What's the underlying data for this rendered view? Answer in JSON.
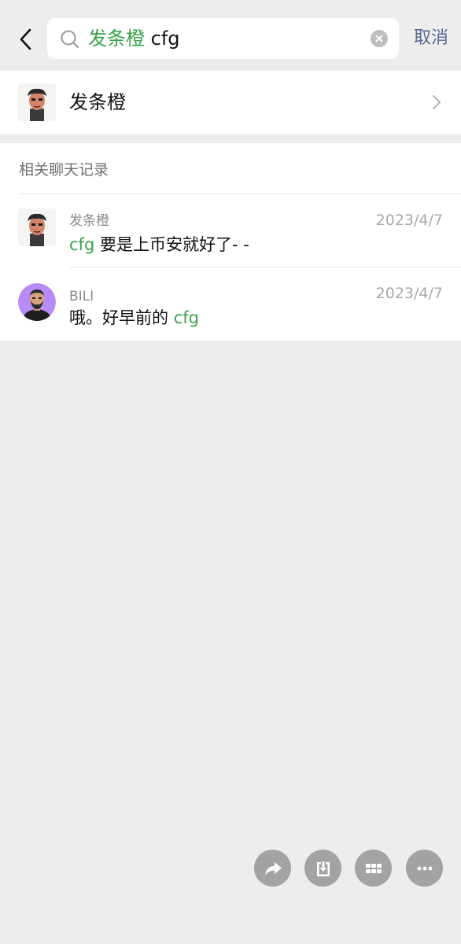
{
  "header": {
    "back_label": "返回",
    "search": {
      "highlight": "发条橙",
      "rest": " cfg"
    },
    "cancel_label": "取消"
  },
  "contact": {
    "name": "发条橙"
  },
  "records": {
    "title": "相关聊天记录",
    "items": [
      {
        "name": "发条橙",
        "date": "2023/4/7",
        "msg_highlight": "cfg",
        "msg_rest": " 要是上币安就好了- -"
      },
      {
        "name": "BILI",
        "date": "2023/4/7",
        "msg_prefix": "哦。好早前的 ",
        "msg_highlight": "cfg"
      }
    ]
  },
  "bottom_actions": [
    "share-icon",
    "save-icon",
    "grid-icon",
    "more-icon"
  ],
  "colors": {
    "highlight": "#3aa24a",
    "cancel": "#576b95",
    "background": "#ededed",
    "bili_avatar_bg": "#b88cf6"
  }
}
